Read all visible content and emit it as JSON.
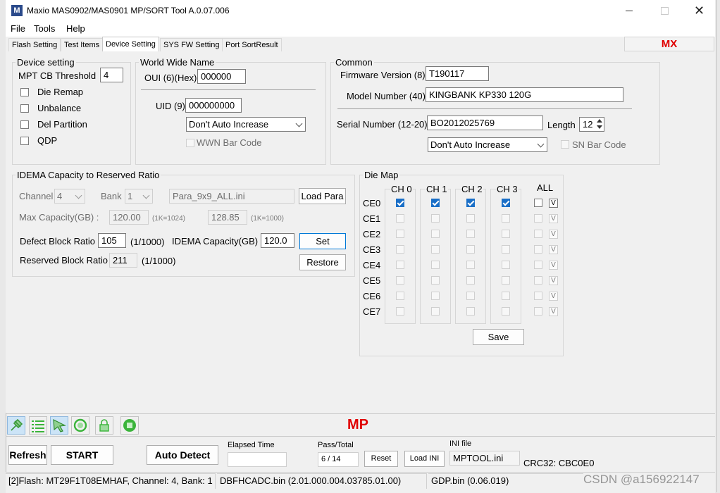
{
  "window": {
    "title": "Maxio MAS0902/MAS0901 MP/SORT Tool A.0.07.006",
    "logo_letter": "M"
  },
  "menu": [
    "File",
    "Tools",
    "Help"
  ],
  "tabs": [
    "Flash Setting",
    "Test Items",
    "Device Setting",
    "SYS FW Setting",
    "Port SortResult"
  ],
  "mx_label": "MX",
  "device_setting": {
    "title": "Device setting",
    "mpt_cb_threshold_label": "MPT CB Threshold",
    "mpt_cb_threshold_value": "4",
    "options": [
      "Die Remap",
      "Unbalance",
      "Del Partition",
      "QDP"
    ]
  },
  "wwn": {
    "title": "World Wide Name",
    "oui_label": "OUI (6)(Hex)",
    "oui_value": "000000",
    "uid_label": "UID (9)",
    "uid_value": "000000000",
    "increase_option": "Don't Auto Increase",
    "bar_code_label": "WWN Bar Code"
  },
  "common": {
    "title": "Common",
    "firmware_label": "Firmware Version (8)",
    "firmware_value": "T190117",
    "model_label": "Model Number (40)",
    "model_value": "KINGBANK KP330 120G",
    "serial_label": "Serial Number (12-20)",
    "serial_value": "BO2012025769",
    "length_label": "Length",
    "length_value": "12",
    "increase_option": "Don't Auto Increase",
    "sn_bar_code_label": "SN Bar Code"
  },
  "idema": {
    "title": "IDEMA Capacity to Reserved Ratio",
    "channel_label": "Channel",
    "channel_value": "4",
    "bank_label": "Bank",
    "bank_value": "1",
    "para_file": "Para_9x9_ALL.ini",
    "load_para_label": "Load Para",
    "max_capacity_label": "Max Capacity(GB) :",
    "max_cap_1": "120.00",
    "max_cap_1_unit": "(1K=1024)",
    "max_cap_2": "128.85",
    "max_cap_2_unit": "(1K=1000)",
    "defect_label": "Defect Block Ratio",
    "defect_value": "105",
    "defect_unit": "(1/1000)",
    "idema_cap_label": "IDEMA Capacity(GB)",
    "idema_cap_value": "120.0",
    "set_label": "Set",
    "reserved_label": "Reserved Block Ratio",
    "reserved_value": "211",
    "reserved_unit": "(1/1000)",
    "restore_label": "Restore"
  },
  "die_map": {
    "title": "Die Map",
    "channels": [
      "CH 0",
      "CH 1",
      "CH 2",
      "CH 3"
    ],
    "all_label": "ALL",
    "rows": [
      "CE0",
      "CE1",
      "CE2",
      "CE3",
      "CE4",
      "CE5",
      "CE6",
      "CE7"
    ],
    "v_label": "V",
    "save_label": "Save"
  },
  "mp_label": "MP",
  "bottom": {
    "refresh_label": "Refresh",
    "start_label": "START",
    "auto_detect_label": "Auto Detect",
    "elapsed_label": "Elapsed Time",
    "elapsed_value": "",
    "pass_total_label": "Pass/Total",
    "pass_total_value": "6 / 14",
    "reset_label": "Reset",
    "load_ini_label": "Load INI",
    "ini_file_label": "INI file",
    "ini_file_value": "MPTOOL.ini",
    "crc_label": "CRC32: CBC0E0"
  },
  "status": {
    "flash_info": "[2]Flash: MT29F1T08EMHAF, Channel: 4, Bank: 1",
    "fw_bin": "DBFHCADC.bin (2.01.000.004.03785.01.00)",
    "gdp_bin": "GDP.bin (0.06.019)"
  },
  "watermark": "CSDN @a156922147",
  "colors": {
    "accent_red": "#e00000",
    "check_blue": "#1a6fc7",
    "logo_bg": "#2b4a8b"
  }
}
